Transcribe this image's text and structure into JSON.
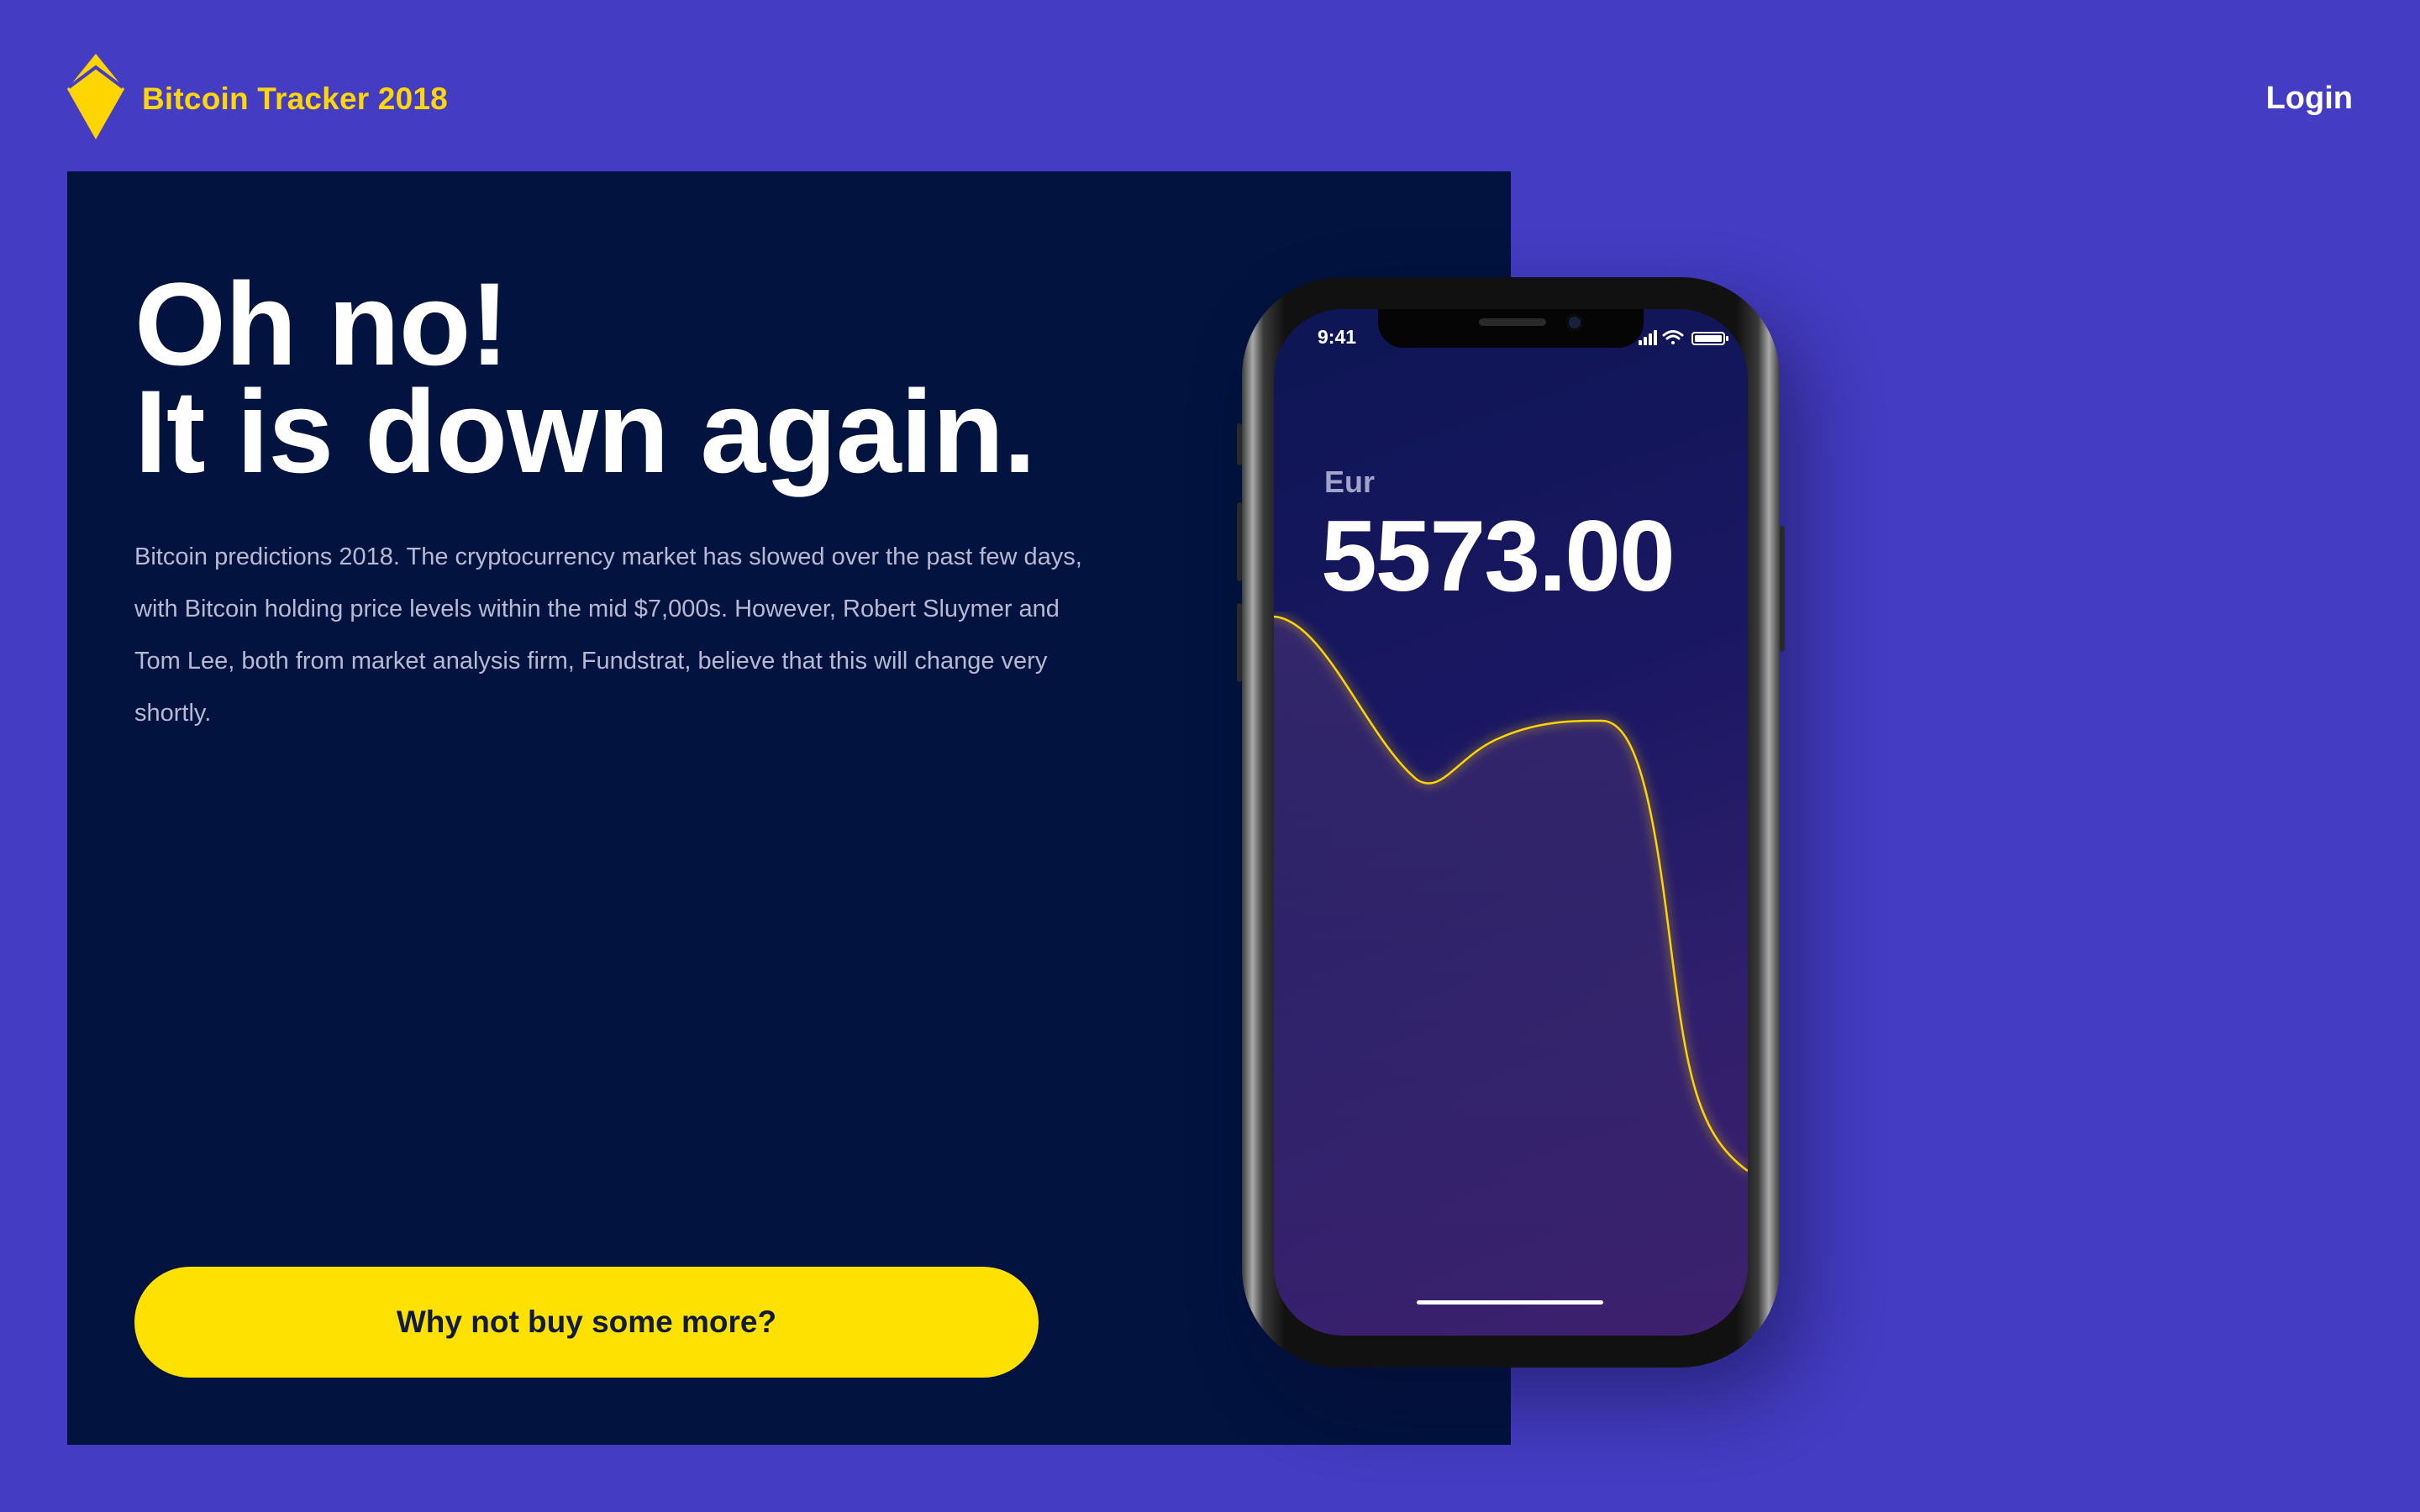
{
  "header": {
    "brand": "Bitcoin Tracker 2018",
    "login_label": "Login",
    "logo_icon": "yellow-diamond-logo-icon"
  },
  "hero": {
    "title_line1": "Oh no!",
    "title_line2": "It is down again.",
    "body": "Bitcoin predictions 2018. The cryptocurrency market has slowed over the past few days, with Bitcoin holding price levels within the mid $7,000s. However, Robert Sluymer and Tom Lee, both from market analysis firm, Fundstrat, believe that this will change very shortly.",
    "cta_label": "Why not buy some more?"
  },
  "phone": {
    "status_time": "9:41",
    "currency": "Eur",
    "price": "5573.00",
    "status_icons": [
      "signal-icon",
      "wifi-icon",
      "battery-icon"
    ]
  },
  "colors": {
    "background": "#443cc2",
    "panel": "#01133e",
    "accent_yellow": "#ffe100",
    "brand_yellow": "#ffd707"
  }
}
